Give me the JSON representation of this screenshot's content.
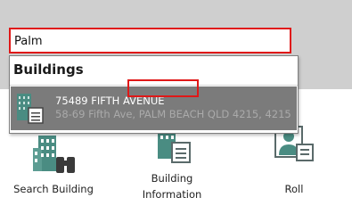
{
  "search": {
    "value": "Palm"
  },
  "dropdown": {
    "header": "Buildings",
    "results": [
      {
        "title": "75489 FIFTH AVENUE",
        "subtitle": "58-69 Fifth Ave, PALM BEACH QLD 4215, 4215",
        "icon": "building-document-icon"
      }
    ]
  },
  "ribbon": {
    "tiles": [
      {
        "label": "Search Building",
        "icon": "building-binoculars-icon"
      },
      {
        "label_line1": "Building",
        "label_line2": "Information",
        "icon": "building-document-icon"
      },
      {
        "label": "Roll",
        "icon": "person-card-icon"
      }
    ]
  },
  "colors": {
    "highlight_red": "#e01818",
    "building_green": "#4a8c82",
    "selection_grey": "#7b7b7b"
  }
}
